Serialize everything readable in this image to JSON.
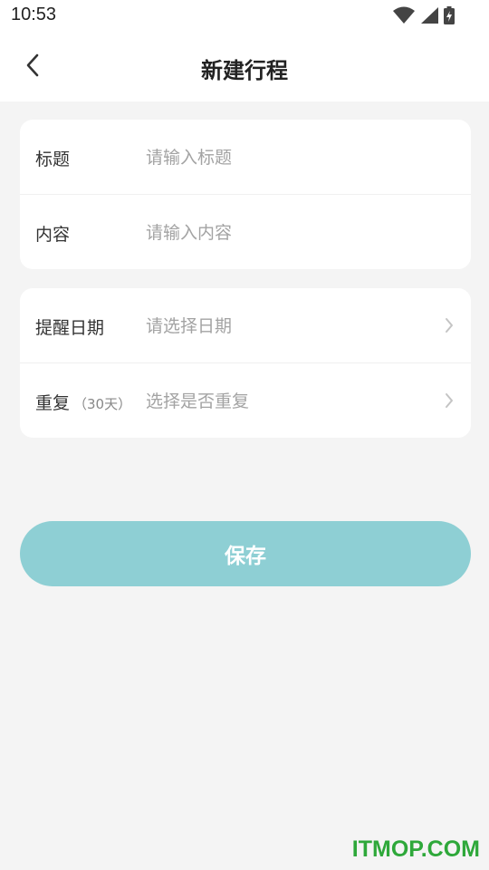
{
  "status_bar": {
    "time": "10:53",
    "icons": [
      "wifi-icon",
      "signal-icon",
      "battery-charging-icon"
    ]
  },
  "header": {
    "title": "新建行程",
    "back_icon": "chevron-left-icon"
  },
  "form": {
    "basic": [
      {
        "label": "标题",
        "placeholder": "请输入标题"
      },
      {
        "label": "内容",
        "placeholder": "请输入内容"
      }
    ],
    "schedule": [
      {
        "label": "提醒日期",
        "note": "",
        "placeholder": "请选择日期"
      },
      {
        "label": "重复",
        "note": "（30天）",
        "placeholder": "选择是否重复"
      }
    ]
  },
  "actions": {
    "save_label": "保存"
  },
  "watermark": "ITMOP.COM",
  "colors": {
    "accent": "#8ecfd4",
    "background": "#f4f4f4",
    "watermark": "#2ea83a"
  }
}
